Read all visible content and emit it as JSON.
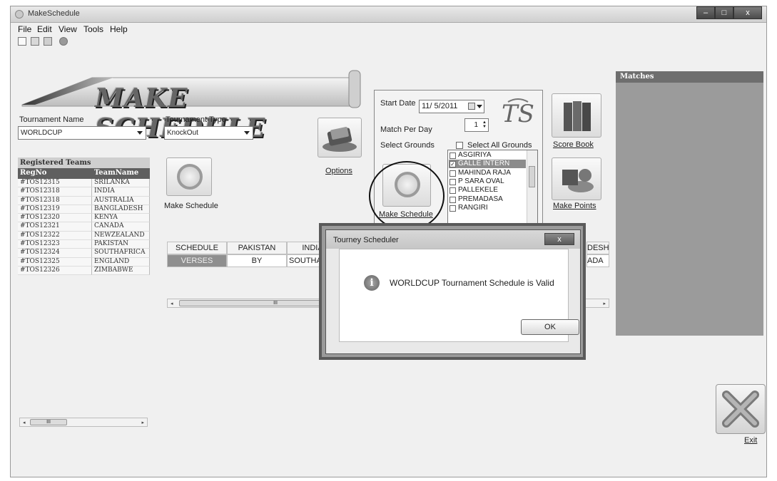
{
  "window": {
    "title": "MakeSchedule",
    "minimize": "–",
    "maximize": "□",
    "close": "x"
  },
  "menu": [
    "File",
    "Edit",
    "View",
    "Tools",
    "Help"
  ],
  "toolbar_icons": [
    "new-file-icon",
    "save-icon",
    "print-icon",
    "help-icon"
  ],
  "banner": {
    "title": "MAKE SCHEDULE"
  },
  "tournament_name": {
    "label": "Tournament Name",
    "value": "WORLDCUP"
  },
  "tournament_type": {
    "label": "Tournament Type",
    "value": "KnockOut"
  },
  "registered_teams": {
    "header": "Registered Teams",
    "columns": [
      "RegNo",
      "TeamName"
    ],
    "rows": [
      [
        "#TOS12315",
        "SRILANKA"
      ],
      [
        "#TOS12318",
        "INDIA"
      ],
      [
        "#TOS12318",
        "AUSTRALIA"
      ],
      [
        "#TOS12319",
        "BANGLADESH"
      ],
      [
        "#TOS12320",
        "KENYA"
      ],
      [
        "#TOS12321",
        "CANADA"
      ],
      [
        "#TOS12322",
        "NEWZEALAND"
      ],
      [
        "#TOS12323",
        "PAKISTAN"
      ],
      [
        "#TOS12324",
        "SOUTHAFRICA"
      ],
      [
        "#TOS12325",
        "ENGLAND"
      ],
      [
        "#TOS12326",
        "ZIMBABWE"
      ]
    ]
  },
  "left_buttons": {
    "make_schedule": "Make Schedule",
    "options": "Options"
  },
  "schedule_grid": {
    "row1": [
      "SCHEDULE",
      "PAKISTAN",
      "INDIA",
      "",
      "",
      "",
      "",
      "",
      "DESH"
    ],
    "row2": [
      "VERSES",
      "BY",
      "SOUTHAF",
      "",
      "",
      "",
      "",
      "",
      "ADA"
    ]
  },
  "scroll_thumb_glyph": "III",
  "options_panel": {
    "start_date_label": "Start Date",
    "start_date_value": "11/ 5/2011",
    "match_per_day_label": "Match Per Day",
    "match_per_day_value": "1",
    "select_grounds_label": "Select Grounds",
    "select_all_label": "Select All Grounds",
    "make_schedule": "Make Schedule",
    "logo": "TS",
    "grounds": [
      {
        "name": "ASGIRIYA",
        "checked": false
      },
      {
        "name": "GALLE INTERN",
        "checked": true
      },
      {
        "name": "MAHINDA RAJA",
        "checked": false
      },
      {
        "name": "P SARA OVAL",
        "checked": false
      },
      {
        "name": "PALLEKELE",
        "checked": false
      },
      {
        "name": "PREMADASA",
        "checked": false
      },
      {
        "name": "RANGIRI",
        "checked": false
      }
    ]
  },
  "right_buttons": {
    "score_book": "Score Book",
    "make_points": "Make Points"
  },
  "matches": {
    "header": "Matches"
  },
  "dialog": {
    "title": "Tourney Scheduler",
    "message": "WORLDCUP Tournament Schedule is Valid",
    "ok": "OK",
    "close": "x"
  },
  "exit": {
    "label": "Exit"
  }
}
